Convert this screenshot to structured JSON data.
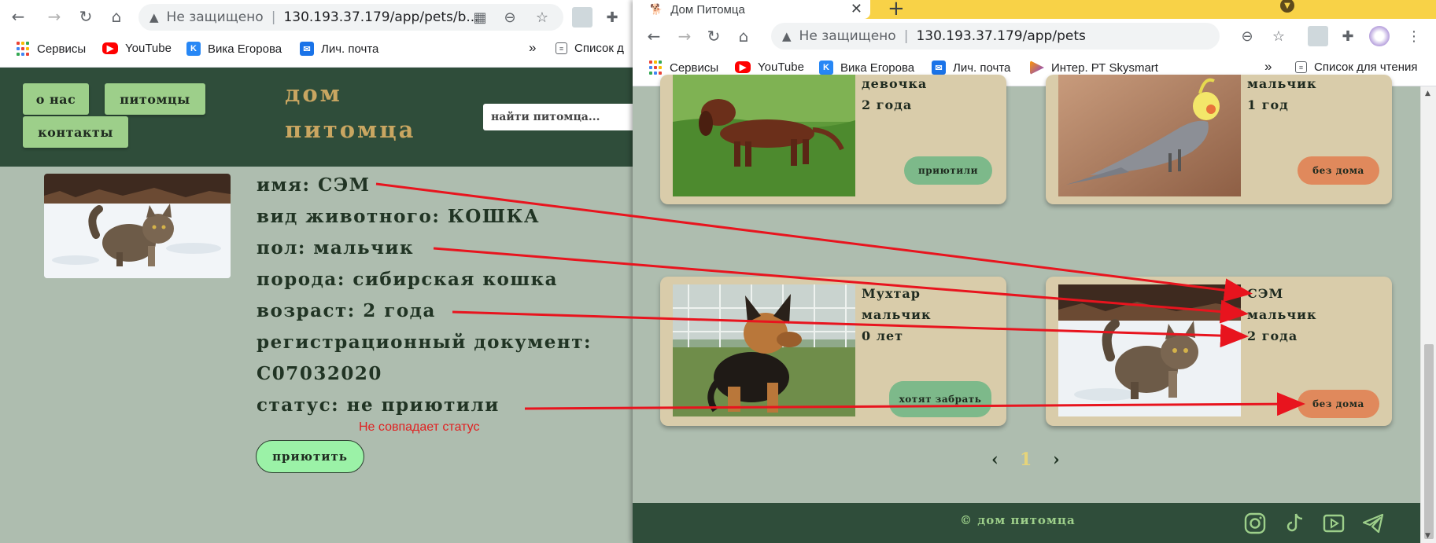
{
  "left_browser": {
    "address": {
      "insecure_label": "Не защищено",
      "url": "130.193.37.179/app/pets/b..."
    },
    "bookmarks": [
      "Сервисы",
      "YouTube",
      "Вика Егорова",
      "Лич. почта"
    ],
    "bookmarks_overflow": "»",
    "reading_list": "Список д"
  },
  "left_site": {
    "menu": [
      "о нас",
      "питомцы",
      "контакты"
    ],
    "logo_lines": [
      "дом",
      "питомца"
    ],
    "search_placeholder": "найти питомца..."
  },
  "pet_detail": {
    "lines": [
      "имя: СЭМ",
      "вид животного: КОШКА",
      "пол: мальчик",
      "порода: сибирская кошка",
      "возраст: 2 года",
      "регистрационный документ:",
      "C07032020",
      "статус: не приютили"
    ],
    "annotation": "Не совпадает статус",
    "adopt_button": "приютить"
  },
  "right_browser": {
    "tab_title": "Дом Питомца",
    "address": {
      "insecure_label": "Не защищено",
      "url": "130.193.37.179/app/pets"
    },
    "bookmarks": [
      "Сервисы",
      "YouTube",
      "Вика Егорова",
      "Лич. почта",
      "Интер. РТ Skysmart"
    ],
    "bookmarks_overflow": "»",
    "reading_list": "Список для чтения"
  },
  "pet_cards": [
    {
      "lines": [
        "девочка",
        "2 года"
      ],
      "status": "приютили",
      "status_color": "#7db98a"
    },
    {
      "lines": [
        "мальчик",
        "1 год"
      ],
      "status": "без дома",
      "status_color": "#e0895c"
    },
    {
      "lines": [
        "Мухтар",
        "мальчик",
        "0 лет"
      ],
      "status": "хотят забрать",
      "status_color": "#7db98a"
    },
    {
      "lines": [
        "СЭМ",
        "мальчик",
        "2 года"
      ],
      "status": "без дома",
      "status_color": "#e0895c"
    }
  ],
  "pagination": {
    "prev": "‹",
    "current": "1",
    "next": "›"
  },
  "footer": {
    "copyright": "© дом питомца"
  },
  "colors": {
    "site_green": "#2f4d3a",
    "page_bg": "#aebdaf",
    "card_bg": "#d9ccaa",
    "menu_green": "#9dcf8a",
    "logo_gold": "#c9a661",
    "annotation_red": "#e02020",
    "tab_strip_yellow": "#f8d247"
  }
}
